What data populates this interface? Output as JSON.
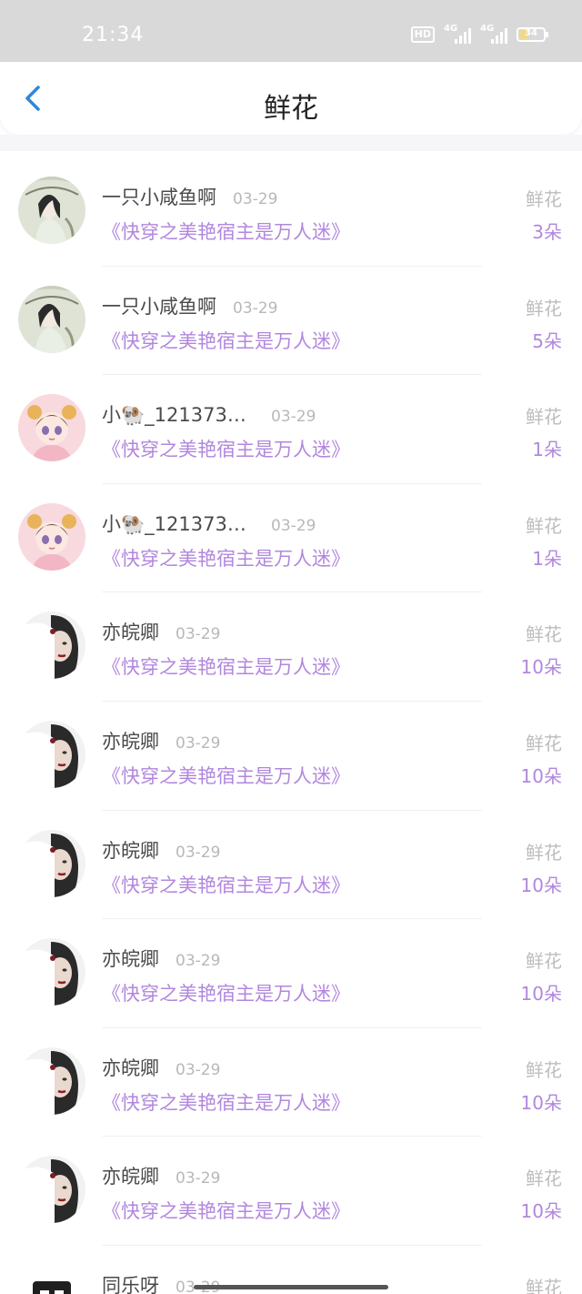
{
  "status_bar": {
    "time": "21:34",
    "hd_label": "HD",
    "net1_label": "4G",
    "net2_label": "4G",
    "battery_level": "34"
  },
  "nav": {
    "title": "鲜花",
    "back_icon": "chevron-left-icon",
    "accent_color": "#2e86de"
  },
  "records": [
    {
      "name": "一只小咸鱼啊",
      "date": "03-29",
      "book": "《快穿之美艳宿主是万人迷》",
      "gift": "鲜花",
      "count": "3朵",
      "avatar": "ink-girl-umbrella"
    },
    {
      "name": "一只小咸鱼啊",
      "date": "03-29",
      "book": "《快穿之美艳宿主是万人迷》",
      "gift": "鲜花",
      "count": "5朵",
      "avatar": "ink-girl-umbrella"
    },
    {
      "name": "小🐏_1213738…",
      "date": "03-29",
      "book": "《快穿之美艳宿主是万人迷》",
      "gift": "鲜花",
      "count": "1朵",
      "avatar": "cute-girl-pink"
    },
    {
      "name": "小🐏_1213738…",
      "date": "03-29",
      "book": "《快穿之美艳宿主是万人迷》",
      "gift": "鲜花",
      "count": "1朵",
      "avatar": "cute-girl-pink"
    },
    {
      "name": "亦皖卿",
      "date": "03-29",
      "book": "《快穿之美艳宿主是万人迷》",
      "gift": "鲜花",
      "count": "10朵",
      "avatar": "woman-white-fan"
    },
    {
      "name": "亦皖卿",
      "date": "03-29",
      "book": "《快穿之美艳宿主是万人迷》",
      "gift": "鲜花",
      "count": "10朵",
      "avatar": "woman-white-fan"
    },
    {
      "name": "亦皖卿",
      "date": "03-29",
      "book": "《快穿之美艳宿主是万人迷》",
      "gift": "鲜花",
      "count": "10朵",
      "avatar": "woman-white-fan"
    },
    {
      "name": "亦皖卿",
      "date": "03-29",
      "book": "《快穿之美艳宿主是万人迷》",
      "gift": "鲜花",
      "count": "10朵",
      "avatar": "woman-white-fan"
    },
    {
      "name": "亦皖卿",
      "date": "03-29",
      "book": "《快穿之美艳宿主是万人迷》",
      "gift": "鲜花",
      "count": "10朵",
      "avatar": "woman-white-fan"
    },
    {
      "name": "亦皖卿",
      "date": "03-29",
      "book": "《快穿之美艳宿主是万人迷》",
      "gift": "鲜花",
      "count": "10朵",
      "avatar": "woman-white-fan"
    },
    {
      "name": "同乐呀",
      "date": "03-29",
      "book": "",
      "gift": "鲜花",
      "count": "",
      "avatar": "dark-logo"
    }
  ]
}
